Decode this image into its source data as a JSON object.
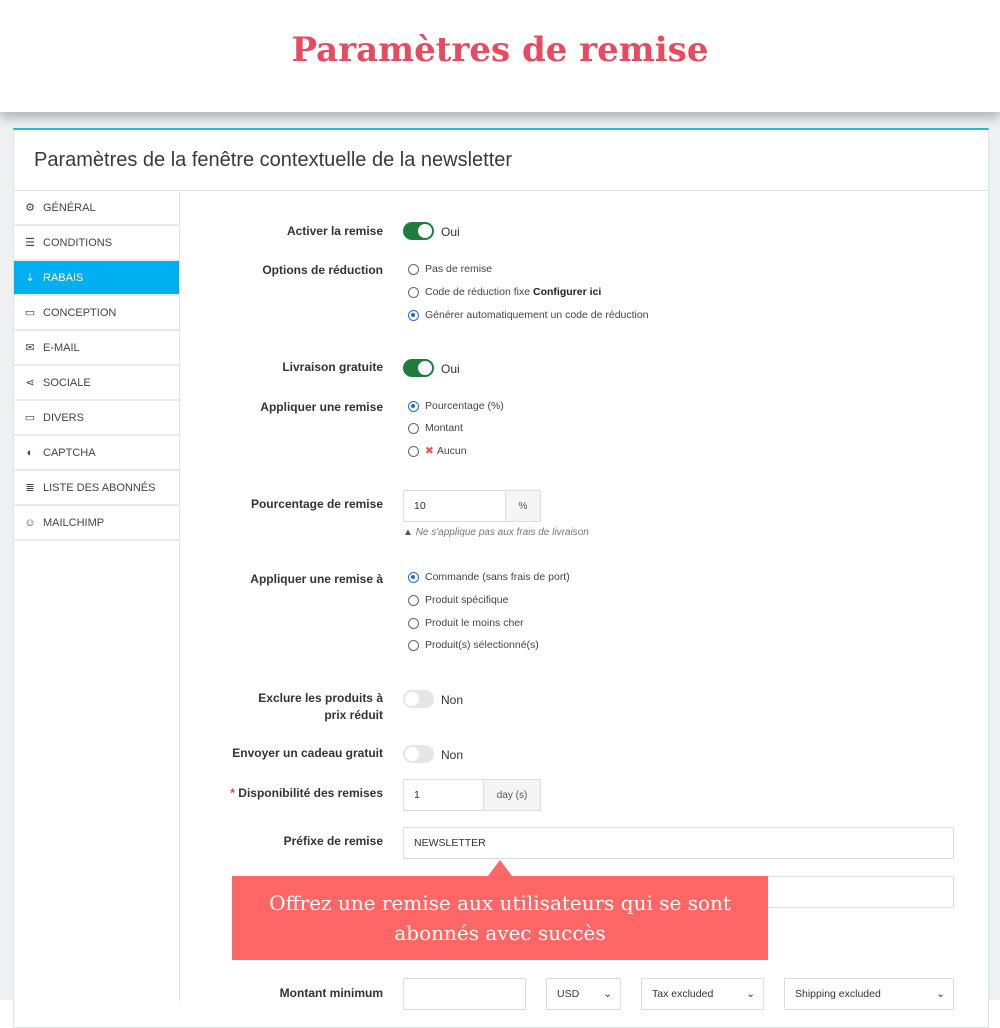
{
  "banner_title": "Paramètres de remise",
  "panel_title": "Paramètres de la fenêtre contextuelle de la newsletter",
  "sidebar": {
    "items": [
      {
        "label": "GÉNÉRAL",
        "icon": "gears-icon",
        "glyph": "⚙"
      },
      {
        "label": "CONDITIONS",
        "icon": "server-icon",
        "glyph": "☰"
      },
      {
        "label": "RABAIS",
        "icon": "sort-amount-icon",
        "glyph": "⇣",
        "active": true
      },
      {
        "label": "CONCEPTION",
        "icon": "window-icon",
        "glyph": "▭"
      },
      {
        "label": "E-MAIL",
        "icon": "envelope-icon",
        "glyph": "✉"
      },
      {
        "label": "SOCIALE",
        "icon": "share-icon",
        "glyph": "⋖"
      },
      {
        "label": "DIVERS",
        "icon": "desktop-icon",
        "glyph": "▭"
      },
      {
        "label": "CAPTCHA",
        "icon": "shield-icon",
        "glyph": "◐"
      },
      {
        "label": "LISTE DES ABONNÉS",
        "icon": "list-icon",
        "glyph": "≣"
      },
      {
        "label": "MAILCHIMP",
        "icon": "mailchimp-icon",
        "glyph": "☺"
      }
    ]
  },
  "form": {
    "activer": {
      "label": "Activer la remise",
      "value": "Oui",
      "on": true
    },
    "options": {
      "label": "Options de réduction",
      "items": [
        "Pas de remise",
        "Code de réduction fixe",
        "Générer automatiquement un code de réduction"
      ],
      "link": "Configurer ici",
      "selected": 2
    },
    "livraison": {
      "label": "Livraison gratuite",
      "value": "Oui",
      "on": true
    },
    "appliquer": {
      "label": "Appliquer une remise",
      "items": [
        "Pourcentage (%)",
        "Montant",
        "Aucun"
      ],
      "selected": 0
    },
    "pourcentage": {
      "label": "Pourcentage de remise",
      "value": "10",
      "addon": "%",
      "note": "Ne s'applique pas aux frais de livraison"
    },
    "appliquer_a": {
      "label": "Appliquer une remise à",
      "items": [
        "Commande (sans frais de port)",
        "Produit spécifique",
        "Produit le moins cher",
        "Produit(s) sélectionné(s)"
      ],
      "selected": 0
    },
    "exclure": {
      "label": "Exclure les produits à prix réduit",
      "value": "Non",
      "on": false
    },
    "cadeau": {
      "label": "Envoyer un cadeau gratuit",
      "value": "Non",
      "on": false
    },
    "disponibilite": {
      "required": "*",
      "label": "Disponibilité des remises",
      "value": "1",
      "addon": "day (s)"
    },
    "prefixe": {
      "label": "Préfixe de remise",
      "value": "NEWSLETTER"
    },
    "montant": {
      "label": "Montant minimum",
      "currency": "USD",
      "tax": "Tax excluded",
      "shipping": "Shipping excluded"
    }
  },
  "callout": "Offrez une remise aux utilisateurs qui se sont abonnés avec succès",
  "colors": {
    "title": "#e84a5f",
    "active_tab": "#00aff0",
    "toggle_on": "#1e7d3c",
    "callout": "#ff6666"
  }
}
